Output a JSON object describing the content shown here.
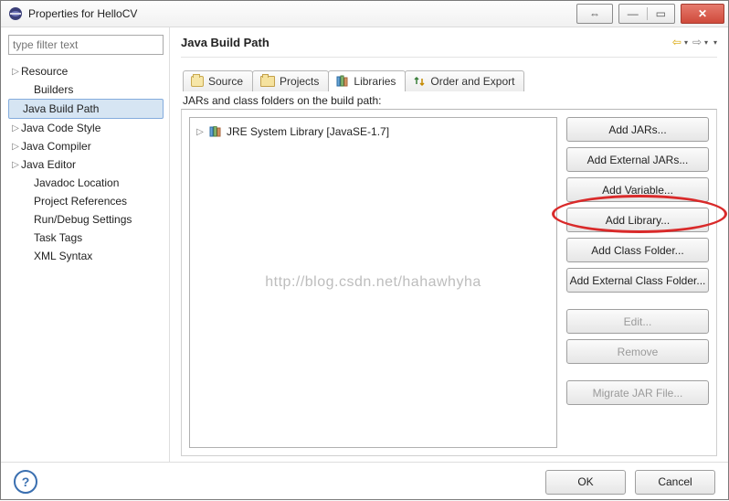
{
  "window": {
    "title": "Properties for HelloCV"
  },
  "filter": {
    "placeholder": "type filter text"
  },
  "tree": {
    "items": [
      {
        "label": "Resource",
        "expandable": true,
        "indent": false
      },
      {
        "label": "Builders",
        "expandable": false,
        "indent": true
      },
      {
        "label": "Java Build Path",
        "expandable": false,
        "indent": true,
        "selected": true
      },
      {
        "label": "Java Code Style",
        "expandable": true,
        "indent": false
      },
      {
        "label": "Java Compiler",
        "expandable": true,
        "indent": false
      },
      {
        "label": "Java Editor",
        "expandable": true,
        "indent": false
      },
      {
        "label": "Javadoc Location",
        "expandable": false,
        "indent": true
      },
      {
        "label": "Project References",
        "expandable": false,
        "indent": true
      },
      {
        "label": "Run/Debug Settings",
        "expandable": false,
        "indent": true
      },
      {
        "label": "Task Tags",
        "expandable": false,
        "indent": true
      },
      {
        "label": "XML Syntax",
        "expandable": false,
        "indent": true
      }
    ]
  },
  "page": {
    "heading": "Java Build Path",
    "tabs": {
      "source": "Source",
      "projects": "Projects",
      "libraries": "Libraries",
      "order": "Order and Export"
    },
    "desc": "JARs and class folders on the build path:",
    "lib_item": "JRE System Library [JavaSE-1.7]",
    "watermark": "http://blog.csdn.net/hahawhyha"
  },
  "buttons": {
    "add_jars": "Add JARs...",
    "add_ext_jars": "Add External JARs...",
    "add_variable": "Add Variable...",
    "add_library": "Add Library...",
    "add_class_folder": "Add Class Folder...",
    "add_ext_class_folder": "Add External Class Folder...",
    "edit": "Edit...",
    "remove": "Remove",
    "migrate": "Migrate JAR File..."
  },
  "footer": {
    "ok": "OK",
    "cancel": "Cancel"
  }
}
